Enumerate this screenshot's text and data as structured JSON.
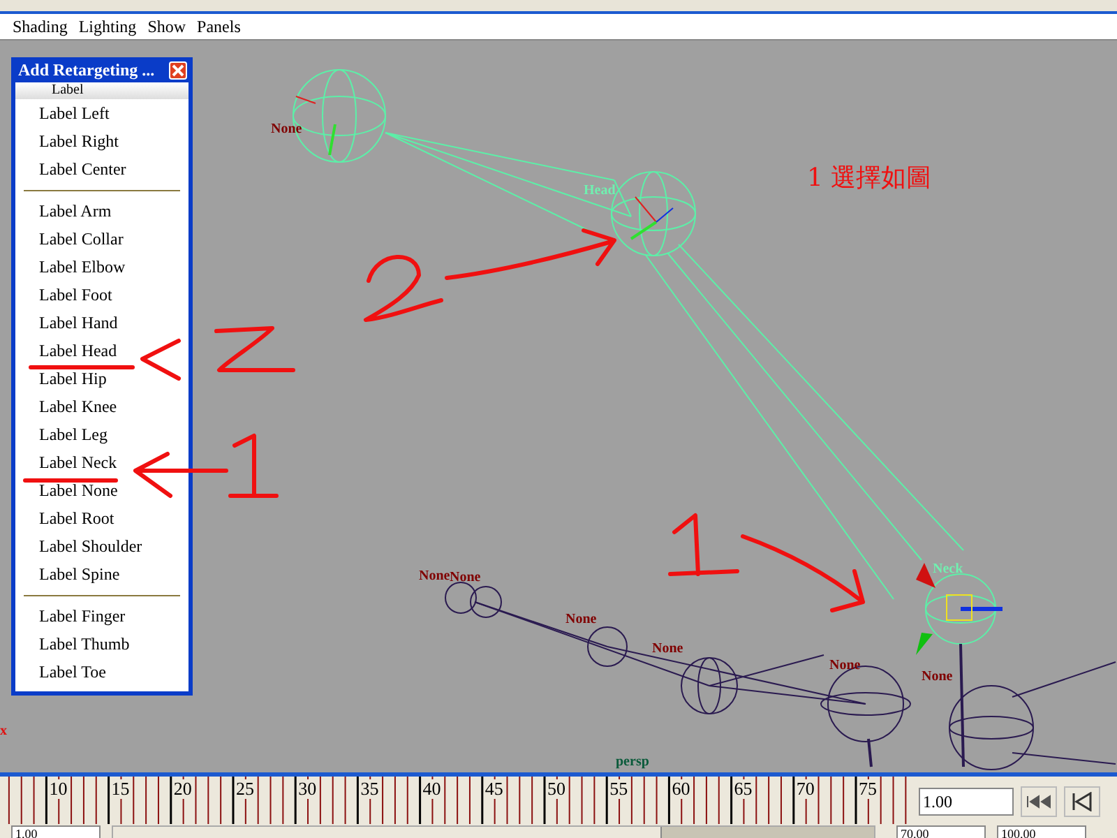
{
  "menubar": {
    "items": [
      "Shading",
      "Lighting",
      "Show",
      "Panels"
    ]
  },
  "popup": {
    "title": "Add Retargeting ...",
    "tearoff_text": "Label",
    "sections": [
      [
        "Label Left",
        "Label Right",
        "Label Center"
      ],
      [
        "Label Arm",
        "Label Collar",
        "Label Elbow",
        "Label Foot",
        "Label Hand",
        "Label Head",
        "Label Hip",
        "Label Knee",
        "Label Leg",
        "Label Neck",
        "Label None",
        "Label Root",
        "Label Shoulder",
        "Label Spine"
      ],
      [
        "Label Finger",
        "Label Thumb",
        "Label Toe"
      ]
    ]
  },
  "viewport": {
    "annotation": "1  選擇如圖",
    "camera": "persp",
    "axis_label": "x",
    "joints": [
      {
        "label": "None",
        "selected": false
      },
      {
        "label": "Head",
        "selected": true
      },
      {
        "label": "Neck",
        "selected": true
      },
      {
        "label": "None",
        "selected": false
      },
      {
        "label": "None",
        "selected": false
      },
      {
        "label": "None",
        "selected": false
      },
      {
        "label": "None",
        "selected": false
      },
      {
        "label": "None",
        "selected": false
      },
      {
        "label": "None",
        "selected": false
      }
    ]
  },
  "timeline": {
    "tick_labels": [
      "10",
      "15",
      "20",
      "25",
      "30",
      "35",
      "40",
      "45",
      "50",
      "55",
      "60",
      "65",
      "70",
      "75"
    ],
    "current_time": "1.00"
  },
  "range_bar": {
    "level": 0.72,
    "start": "1.00",
    "end": "70.00",
    "total_end": "100.00"
  }
}
